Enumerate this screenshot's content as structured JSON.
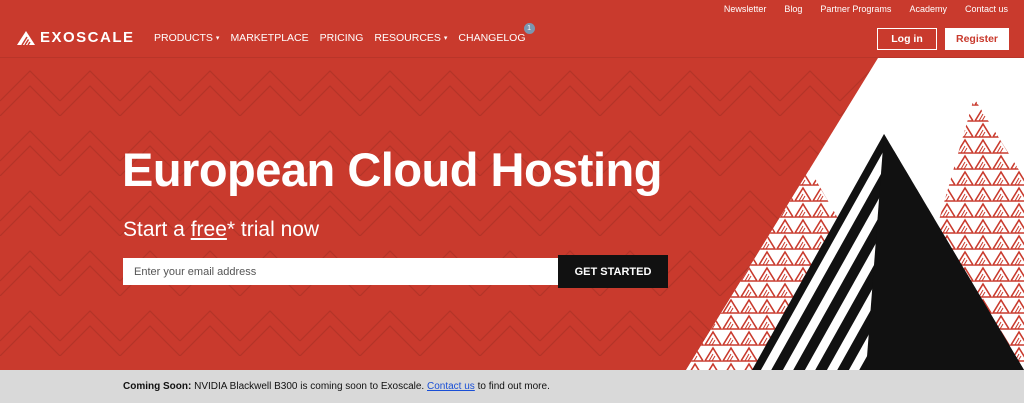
{
  "topbar": {
    "links": [
      "Newsletter",
      "Blog",
      "Partner Programs",
      "Academy",
      "Contact us"
    ]
  },
  "nav": {
    "logo_text": "EXOSCALE",
    "items": [
      {
        "label": "PRODUCTS",
        "dropdown": true
      },
      {
        "label": "MARKETPLACE",
        "dropdown": false
      },
      {
        "label": "PRICING",
        "dropdown": false
      },
      {
        "label": "RESOURCES",
        "dropdown": true
      },
      {
        "label": "CHANGELOG",
        "dropdown": false,
        "badge": "1"
      }
    ],
    "login_label": "Log in",
    "register_label": "Register"
  },
  "hero": {
    "headline": "European Cloud Hosting",
    "sub_prefix": "Start a ",
    "sub_link": "free",
    "sub_suffix": "* trial now",
    "email_placeholder": "Enter your email address",
    "cta_label": "GET STARTED"
  },
  "banner": {
    "bold": "Coming Soon:",
    "text": " NVIDIA Blackwell B300 is coming soon to Exoscale. ",
    "link": "Contact us",
    "suffix": " to find out more."
  },
  "colors": {
    "brand_red": "#c93a2d",
    "banner_bg": "#d9d9d9",
    "cta_bg": "#111111",
    "badge": "#7b96b0",
    "link_blue": "#1a4fd6"
  }
}
